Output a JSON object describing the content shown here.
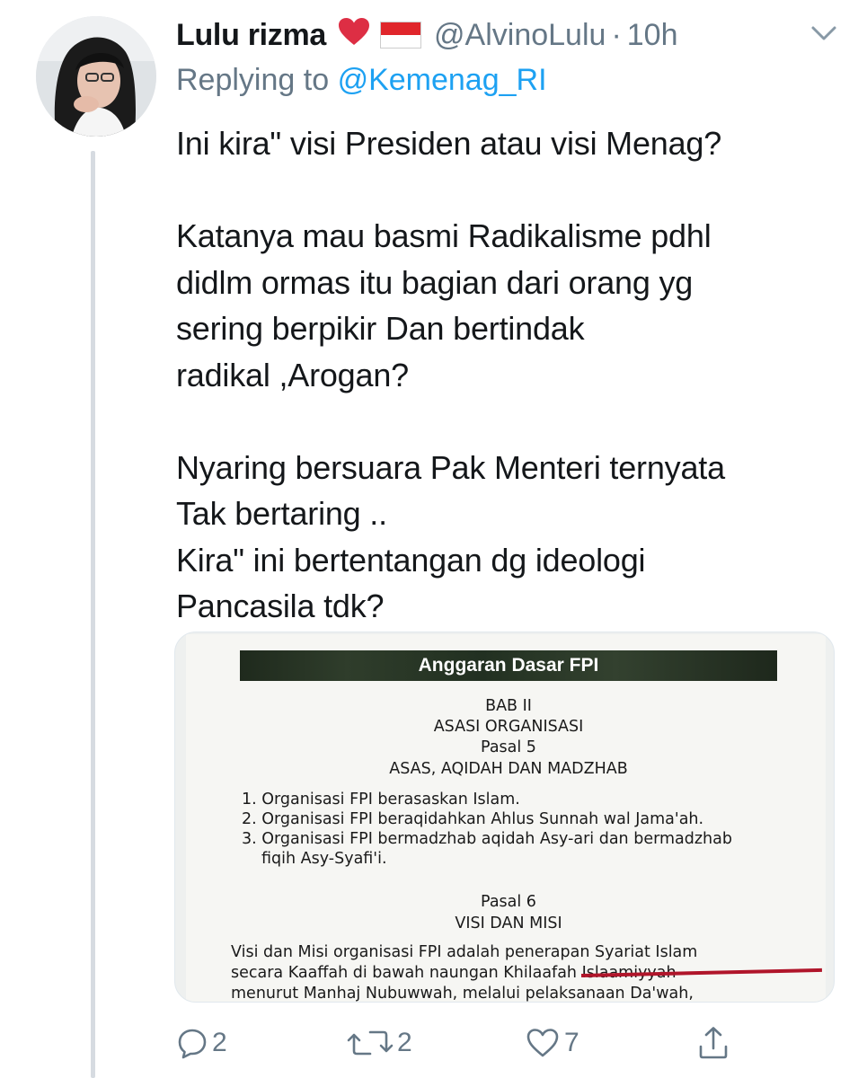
{
  "tweet": {
    "display_name": "Lulu rizma",
    "emoji": "❤️",
    "handle": "@AlvinoLulu",
    "separator": "·",
    "time": "10h",
    "replying_prefix": "Replying to",
    "replying_to": "@Kemenag_RI",
    "text": "Ini kira\" visi Presiden atau visi Menag?\n\nKatanya mau basmi Radikalisme pdhl\ndidlm ormas itu bagian dari orang yg\nsering berpikir Dan bertindak\nradikal ,Arogan?\n\nNyaring bersuara Pak Menteri ternyata\nTak bertaring ..\nKira\" ini bertentangan dg ideologi\nPancasila tdk?"
  },
  "document_image": {
    "banner": "Anggaran Dasar FPI",
    "chapter": "BAB II",
    "chapter_title": "ASASI ORGANISASI",
    "article5": "Pasal 5",
    "article5_title": "ASAS, AQIDAH DAN MADZHAB",
    "items": [
      "1. Organisasi FPI berasaskan Islam.",
      "2. Organisasi FPI beraqidahkan Ahlus Sunnah wal Jama'ah.",
      "3. Organisasi FPI bermadzhab aqidah Asy-ari dan bermadzhab",
      "fiqih Asy-Syafi'i."
    ],
    "article6": "Pasal 6",
    "article6_title": "VISI DAN MISI",
    "paragraph": [
      "Visi dan Misi organisasi FPI adalah penerapan Syariat Islam",
      "secara Kaaffah di bawah naungan Khilaafah Islaamiyyah",
      "menurut Manhaj Nubuwwah, melalui pelaksanaan Da'wah,"
    ]
  },
  "actions": {
    "reply_count": "2",
    "retweet_count": "2",
    "like_count": "7"
  },
  "icons": [
    "reply-icon",
    "retweet-icon",
    "like-icon",
    "share-icon",
    "chevron-down-icon"
  ],
  "colors": {
    "text": "#14171a",
    "secondary": "#657786",
    "mention": "#1da1f2",
    "thread_line": "#d6dbe1"
  }
}
